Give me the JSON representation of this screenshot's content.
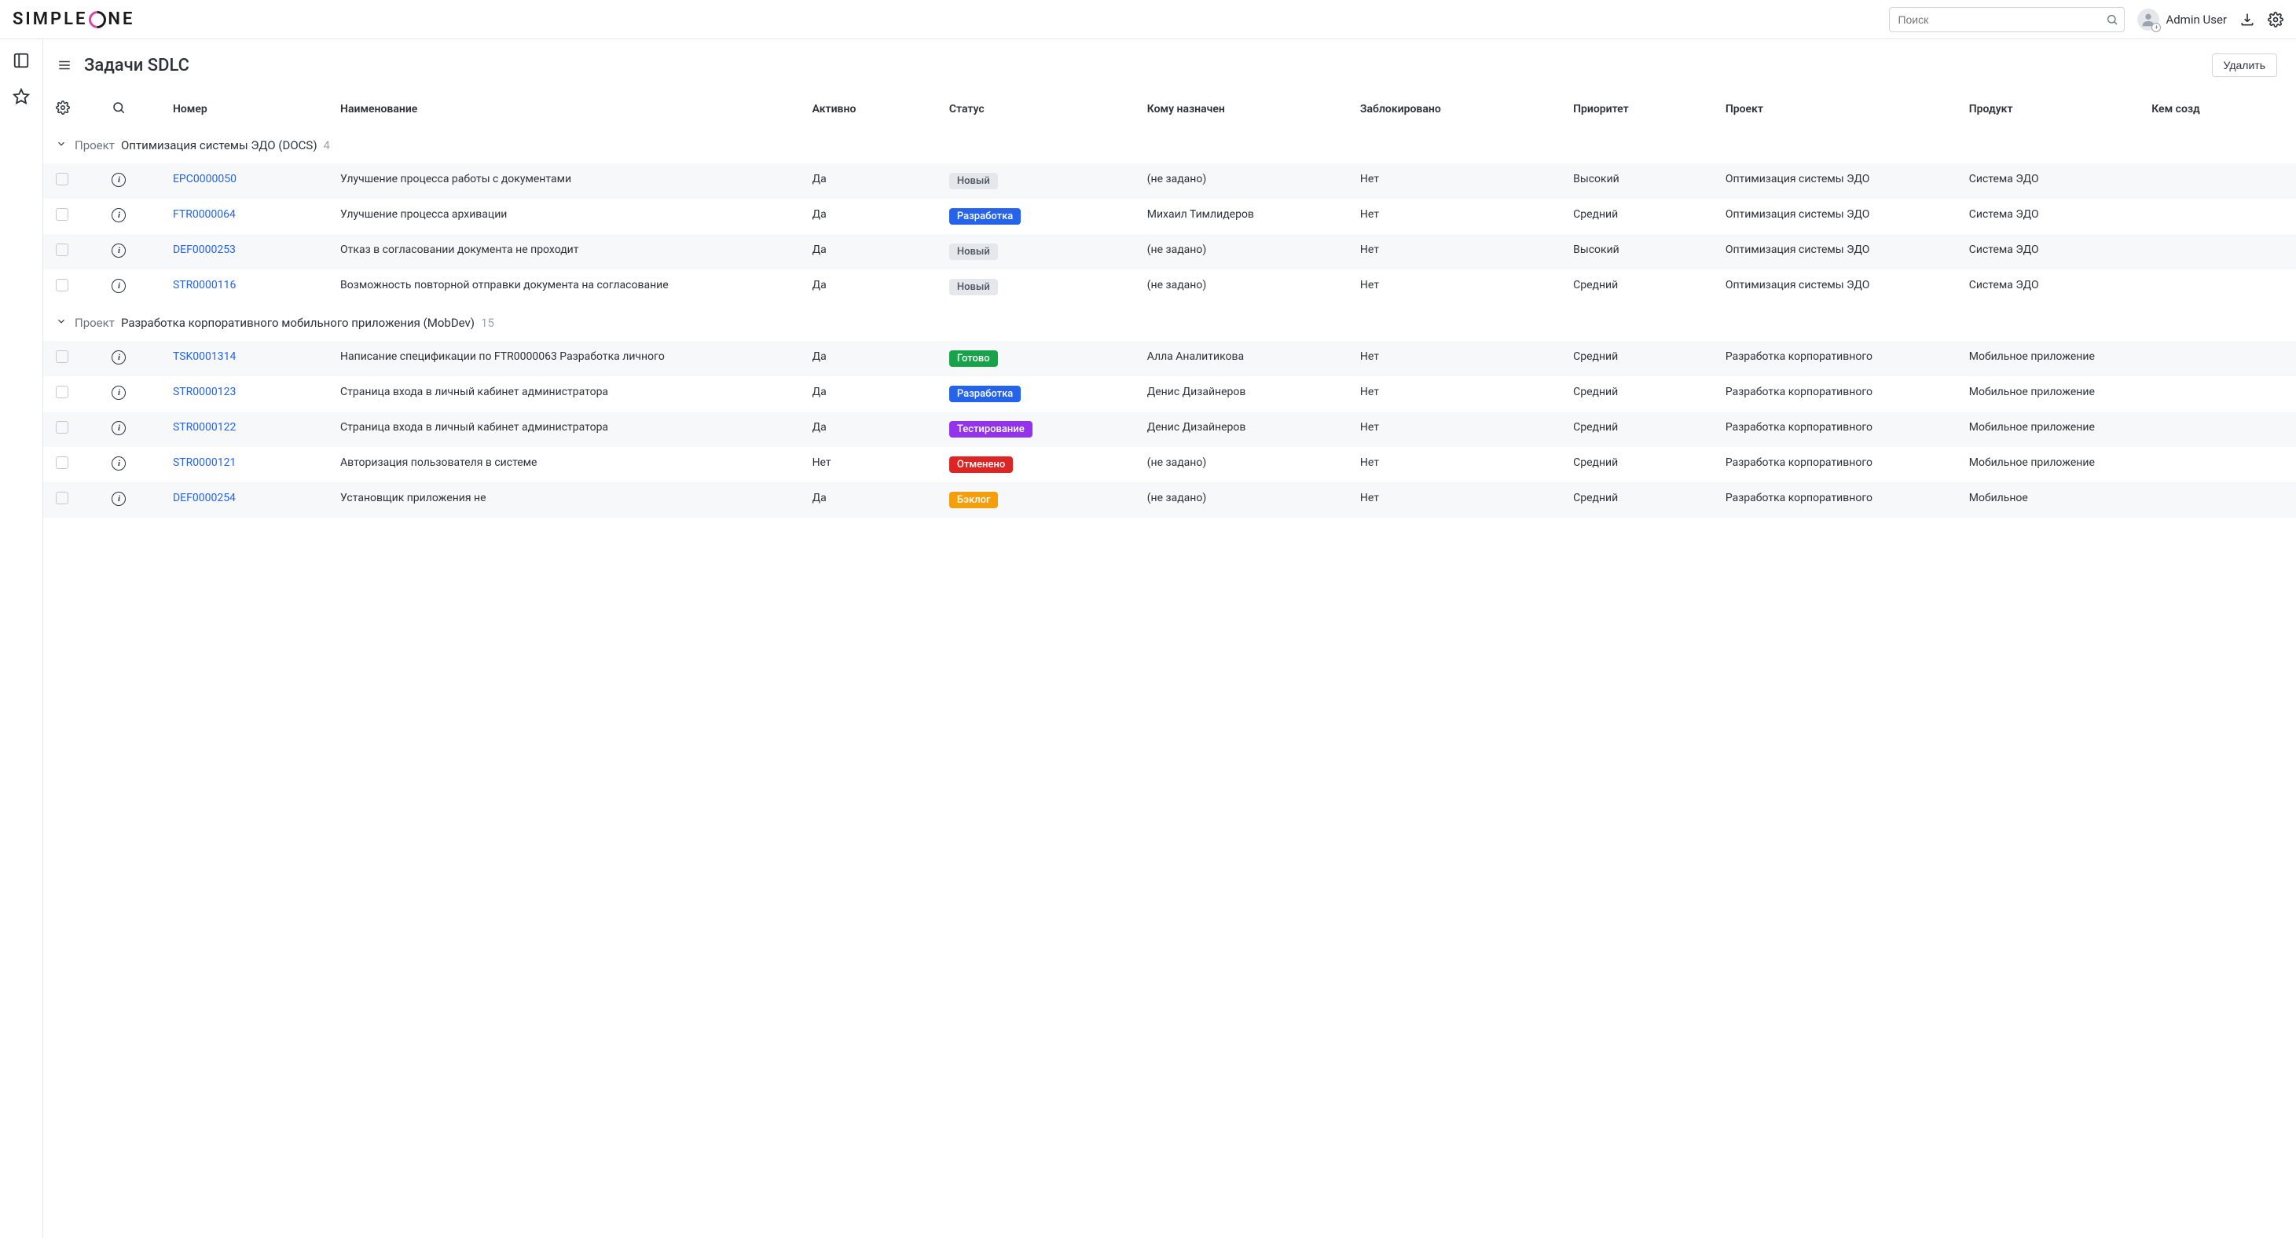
{
  "topbar": {
    "search_placeholder": "Поиск",
    "user_name": "Admin User"
  },
  "page": {
    "title": "Задачи SDLC",
    "delete_label": "Удалить"
  },
  "columns": {
    "number": "Номер",
    "name": "Наименование",
    "active": "Активно",
    "status": "Статус",
    "assignee": "Кому назначен",
    "blocked": "Заблокировано",
    "priority": "Приоритет",
    "project": "Проект",
    "product": "Продукт",
    "created_by": "Кем созд"
  },
  "group_label": "Проект",
  "groups": [
    {
      "name": "Оптимизация системы ЭДО (DOCS)",
      "count": "4",
      "rows": [
        {
          "number": "EPC0000050",
          "name": "Улучшение процесса работы с документами",
          "active": "Да",
          "status": "Новый",
          "status_class": "badge-gray",
          "assignee": "(не задано)",
          "assignee_empty": true,
          "blocked": "Нет",
          "priority": "Высокий",
          "project": "Оптимизация системы ЭДО",
          "product": "Система ЭДО"
        },
        {
          "number": "FTR0000064",
          "name": "Улучшение процесса архивации",
          "active": "Да",
          "status": "Разработка",
          "status_class": "badge-blue",
          "assignee": "Михаил Тимлидеров",
          "assignee_empty": false,
          "blocked": "Нет",
          "priority": "Средний",
          "project": "Оптимизация системы ЭДО",
          "product": "Система ЭДО"
        },
        {
          "number": "DEF0000253",
          "name": "Отказ в согласовании документа не проходит",
          "active": "Да",
          "status": "Новый",
          "status_class": "badge-gray",
          "assignee": "(не задано)",
          "assignee_empty": true,
          "blocked": "Нет",
          "priority": "Высокий",
          "project": "Оптимизация системы ЭДО",
          "product": "Система ЭДО"
        },
        {
          "number": "STR0000116",
          "name": "Возможность повторной отправки документа на согласование",
          "active": "Да",
          "status": "Новый",
          "status_class": "badge-gray",
          "assignee": "(не задано)",
          "assignee_empty": true,
          "blocked": "Нет",
          "priority": "Средний",
          "project": "Оптимизация системы ЭДО",
          "product": "Система ЭДО"
        }
      ]
    },
    {
      "name": "Разработка корпоративного мобильного приложения (MobDev)",
      "count": "15",
      "rows": [
        {
          "number": "TSK0001314",
          "name": "Написание спецификации по FTR0000063 Разработка личного",
          "active": "Да",
          "status": "Готово",
          "status_class": "badge-green",
          "assignee": "Алла Аналитикова",
          "assignee_empty": false,
          "blocked": "Нет",
          "priority": "Средний",
          "project": "Разработка корпоративного",
          "product": "Мобильное приложение"
        },
        {
          "number": "STR0000123",
          "name": "Страница входа в личный кабинет администратора",
          "active": "Да",
          "status": "Разработка",
          "status_class": "badge-blue",
          "assignee": "Денис Дизайнеров",
          "assignee_empty": false,
          "blocked": "Нет",
          "priority": "Средний",
          "project": "Разработка корпоративного",
          "product": "Мобильное приложение"
        },
        {
          "number": "STR0000122",
          "name": "Страница входа в личный кабинет администратора",
          "active": "Да",
          "status": "Тестирование",
          "status_class": "badge-purple",
          "assignee": "Денис Дизайнеров",
          "assignee_empty": false,
          "blocked": "Нет",
          "priority": "Средний",
          "project": "Разработка корпоративного",
          "product": "Мобильное приложение"
        },
        {
          "number": "STR0000121",
          "name": "Авторизация пользователя в системе",
          "active": "Нет",
          "status": "Отменено",
          "status_class": "badge-red",
          "assignee": "(не задано)",
          "assignee_empty": true,
          "blocked": "Нет",
          "priority": "Средний",
          "project": "Разработка корпоративного",
          "product": "Мобильное приложение"
        },
        {
          "number": "DEF0000254",
          "name": "Установщик приложения не",
          "active": "Да",
          "status": "Бэклог",
          "status_class": "badge-orange",
          "assignee": "(не задано)",
          "assignee_empty": true,
          "blocked": "Нет",
          "priority": "Средний",
          "project": "Разработка корпоративного",
          "product": "Мобильное"
        }
      ]
    }
  ]
}
